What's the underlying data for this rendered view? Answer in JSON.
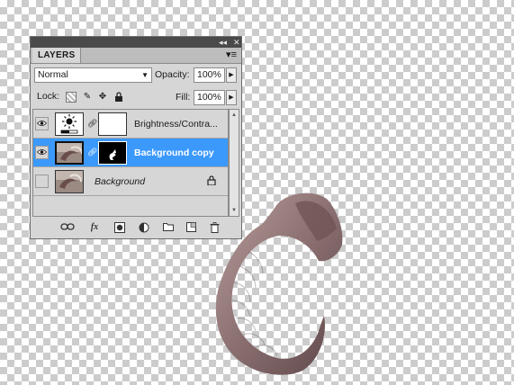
{
  "panel": {
    "tab_label": "LAYERS",
    "blend_mode": "Normal",
    "opacity_label": "Opacity:",
    "opacity_value": "100%",
    "lock_label": "Lock:",
    "fill_label": "Fill:",
    "fill_value": "100%"
  },
  "layers": [
    {
      "name": "Brightness/Contra...",
      "visible": true,
      "selected": false,
      "type": "adjustment"
    },
    {
      "name": "Background copy",
      "visible": true,
      "selected": true,
      "type": "pixel-with-mask"
    },
    {
      "name": "Background",
      "visible": false,
      "selected": false,
      "locked": true,
      "type": "background"
    }
  ],
  "bottom_icons": [
    "link-layers-icon",
    "fx-icon",
    "add-mask-icon",
    "adjustment-layer-icon",
    "new-group-icon",
    "new-layer-icon",
    "delete-layer-icon"
  ],
  "bottom_fx_label": "fx",
  "colors": {
    "selection": "#3b99fc",
    "panel_bg": "#d6d6d6"
  }
}
